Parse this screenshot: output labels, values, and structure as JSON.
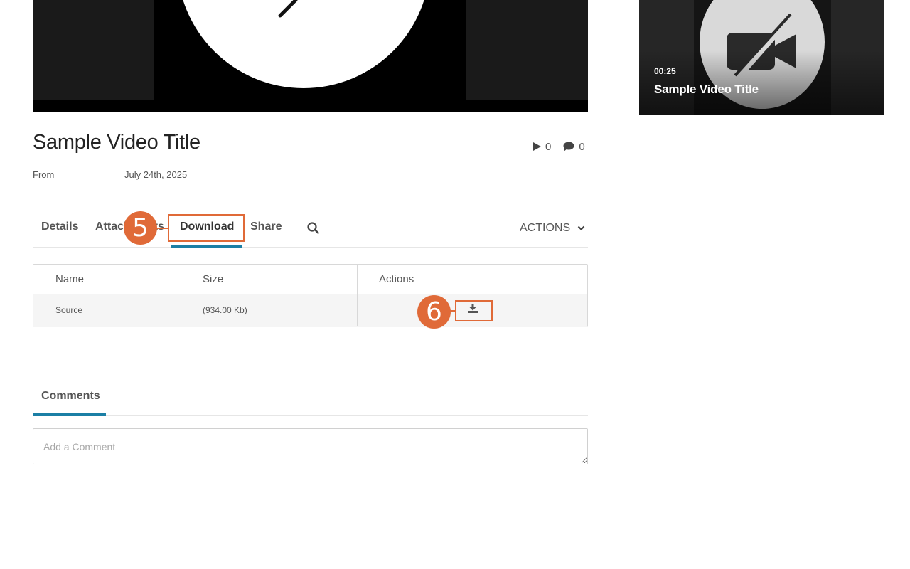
{
  "player": {
    "overlay_icon": "video-off-icon"
  },
  "related": {
    "duration": "00:25",
    "title": "Sample Video Title",
    "thumbnail_icon": "video-off-icon"
  },
  "media": {
    "title": "Sample Video Title",
    "plays": "0",
    "comments": "0",
    "from_label": "From",
    "date": "July 24th, 2025"
  },
  "tabs": {
    "items": [
      {
        "label": "Details"
      },
      {
        "label": "Attachments"
      },
      {
        "label": "Download",
        "active": true
      },
      {
        "label": "Share"
      }
    ],
    "search_icon": "search-icon",
    "actions_label": "ACTIONS",
    "active_color": "#1b7fa5"
  },
  "download_table": {
    "headers": [
      "Name",
      "Size",
      "Actions"
    ],
    "rows": [
      {
        "name": "Source",
        "size": "(934.00 Kb)",
        "action_icon": "download-icon"
      }
    ]
  },
  "comments": {
    "tab_label": "Comments",
    "placeholder": "Add a Comment"
  },
  "callouts": {
    "color": "#e06a38",
    "step_download_tab": "5",
    "step_download_button": "6"
  }
}
